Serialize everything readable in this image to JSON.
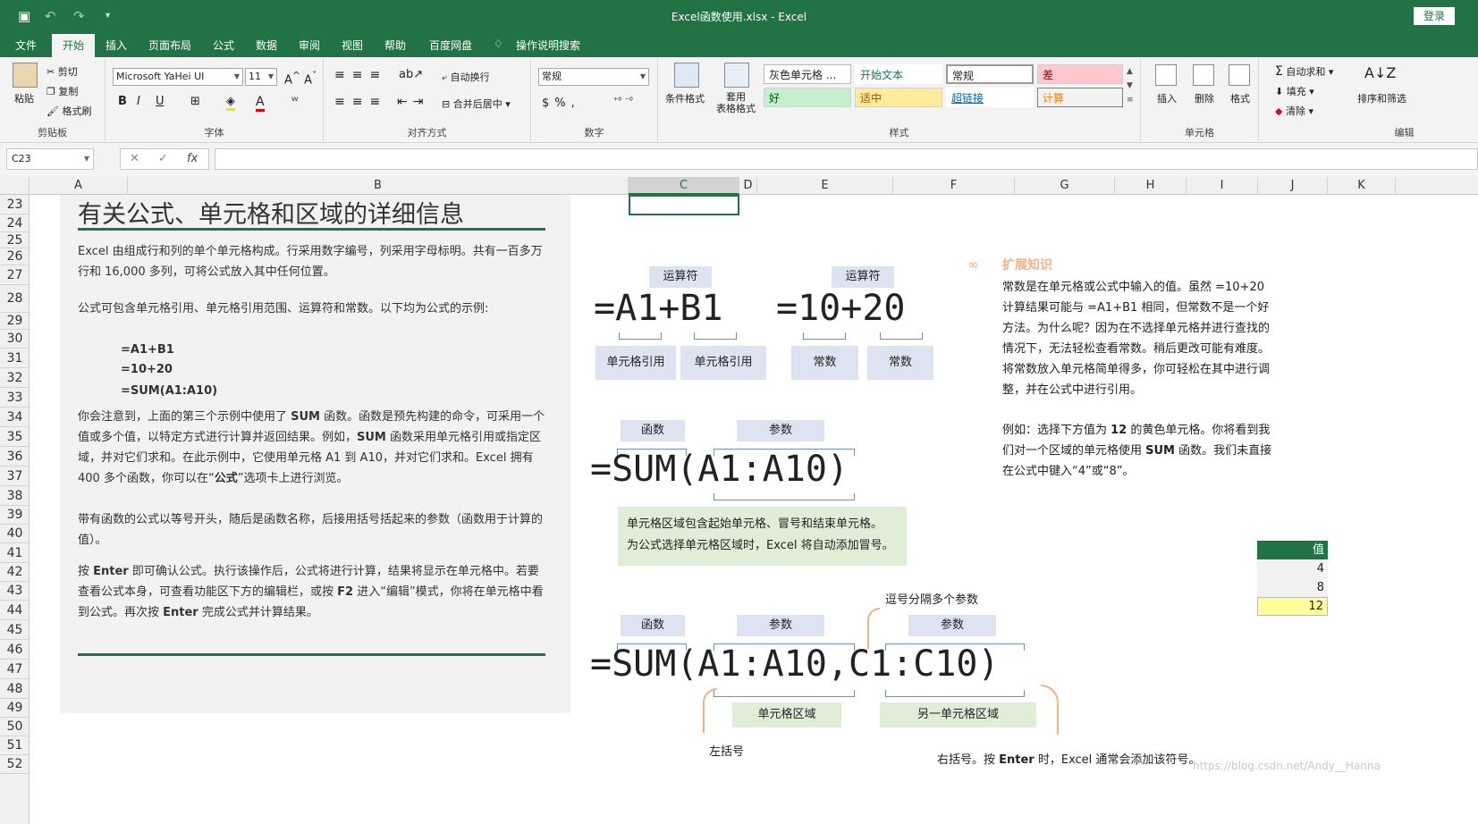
{
  "window": {
    "title": "Excel函数使用.xlsx  -  Excel",
    "login": "登录"
  },
  "tabs": [
    "文件",
    "开始",
    "插入",
    "页面布局",
    "公式",
    "数据",
    "审阅",
    "视图",
    "帮助",
    "百度网盘",
    "操作说明搜索"
  ],
  "ribbon": {
    "clipboard": {
      "paste": "粘贴",
      "cut": "剪切",
      "copy": "复制",
      "format_painter": "格式刷",
      "label": "剪贴板"
    },
    "font": {
      "name": "Microsoft YaHei UI",
      "size": "11",
      "label": "字体"
    },
    "align": {
      "wrap": "自动换行",
      "merge": "合并后居中",
      "label": "对齐方式"
    },
    "number": {
      "format": "常规",
      "label": "数字"
    },
    "styles": {
      "cond": "条件格式",
      "table": "套用\n表格格式",
      "cells": [
        "灰色单元格 ...",
        "开始文本",
        "常规",
        "差",
        "好",
        "适中",
        "超链接",
        "计算"
      ],
      "label": "样式"
    },
    "cells": {
      "insert": "插入",
      "delete": "删除",
      "format": "格式",
      "label": "单元格"
    },
    "editing": {
      "autosum": "自动求和",
      "fill": "填充",
      "clear": "清除",
      "sort": "排序和筛选",
      "label": "编辑"
    }
  },
  "formula_bar": {
    "name_box": "C23",
    "fx": "fx",
    "value": ""
  },
  "columns": [
    "A",
    "B",
    "C",
    "D",
    "E",
    "F",
    "G",
    "H",
    "I",
    "J",
    "K"
  ],
  "rows": [
    "23",
    "24",
    "25",
    "26",
    "27",
    "28",
    "29",
    "30",
    "31",
    "32",
    "33",
    "34",
    "35",
    "36",
    "37",
    "38",
    "39",
    "40",
    "41",
    "42",
    "43",
    "44",
    "45",
    "46",
    "47",
    "48",
    "49",
    "50",
    "51",
    "52"
  ],
  "left": {
    "heading": "有关公式、单元格和区域的详细信息",
    "p1": "Excel 由组成行和列的单个单元格构成。行采用数字编号，列采用字母标明。共有一百多万行和 16,000 多列，可将公式放入其中任何位置。",
    "p2": "公式可包含单元格引用、单元格引用范围、运算符和常数。以下均为公式的示例:",
    "ex1": "=A1+B1",
    "ex2": "=10+20",
    "ex3": "=SUM(A1:A10)",
    "p3a": "你会注意到，上面的第三个示例中使用了 ",
    "p3b": "SUM",
    "p3c": " 函数。函数是预先构建的命令，可采用一个值或多个值，以特定方式进行计算并返回结果。例如，",
    "p3d": "SUM",
    "p3e": " 函数采用单元格引用或指定区域，并对它们求和。在此示例中，它使用单元格 A1 到 A10，并对它们求和。Excel 拥有 400 多个函数，你可以在“",
    "p3f": "公式",
    "p3g": "”选项卡上进行浏览。",
    "p4": "带有函数的公式以等号开头，随后是函数名称，后接用括号括起来的参数（函数用于计算的值）。",
    "p5a": "按 ",
    "p5b": "Enter",
    "p5c": " 即可确认公式。执行该操作后，公式将进行计算，结果将显示在单元格中。若要查看公式本身，可查看功能区下方的编辑栏，或按 ",
    "p5d": "F2",
    "p5e": " 进入“编辑”模式，你将在单元格中看到公式。再次按 ",
    "p5f": "Enter",
    "p5g": " 完成公式并计算结果。"
  },
  "diagram": {
    "op": "运算符",
    "f1": "=A1+B1",
    "f2": "=10+20",
    "cellref": "单元格引用",
    "const": "常数",
    "func": "函数",
    "param": "参数",
    "sum1": "=SUM(A1:A10)",
    "range_note1": "单元格区域包含起始单元格、冒号和结束单元格。",
    "range_note2": "为公式选择单元格区域时，Excel 将自动添加冒号。",
    "comma_note": "逗号分隔多个参数",
    "sum2": "=SUM(A1:A10,C1:C10)",
    "range": "单元格区域",
    "range2": "另一单元格区域",
    "lparen": "左括号",
    "rparen_a": "右括号。按 ",
    "rparen_b": "Enter",
    "rparen_c": " 时，Excel 通常会添加该符号。"
  },
  "right": {
    "title": "扩展知识",
    "p1": "常数是在单元格或公式中输入的值。虽然 =10+20 计算结果可能与 =A1+B1 相同，但常数不是一个好方法。为什么呢？因为在不选择单元格并进行查找的情况下，无法轻松查看常数。稍后更改可能有难度。将常数放入单元格简单得多，你可轻松在其中进行调整，并在公式中进行引用。",
    "p2a": "例如：选择下方值为 ",
    "p2b": "12",
    "p2c": " 的黄色单元格。你将看到我们对一个区域的单元格使用 ",
    "p2d": "SUM",
    "p2e": " 函数。我们未直接在公式中键入“4”或“8”。",
    "table_header": "值",
    "values": [
      "4",
      "8",
      "12"
    ]
  },
  "watermark": "https://blog.csdn.net/Andy__Hanna"
}
